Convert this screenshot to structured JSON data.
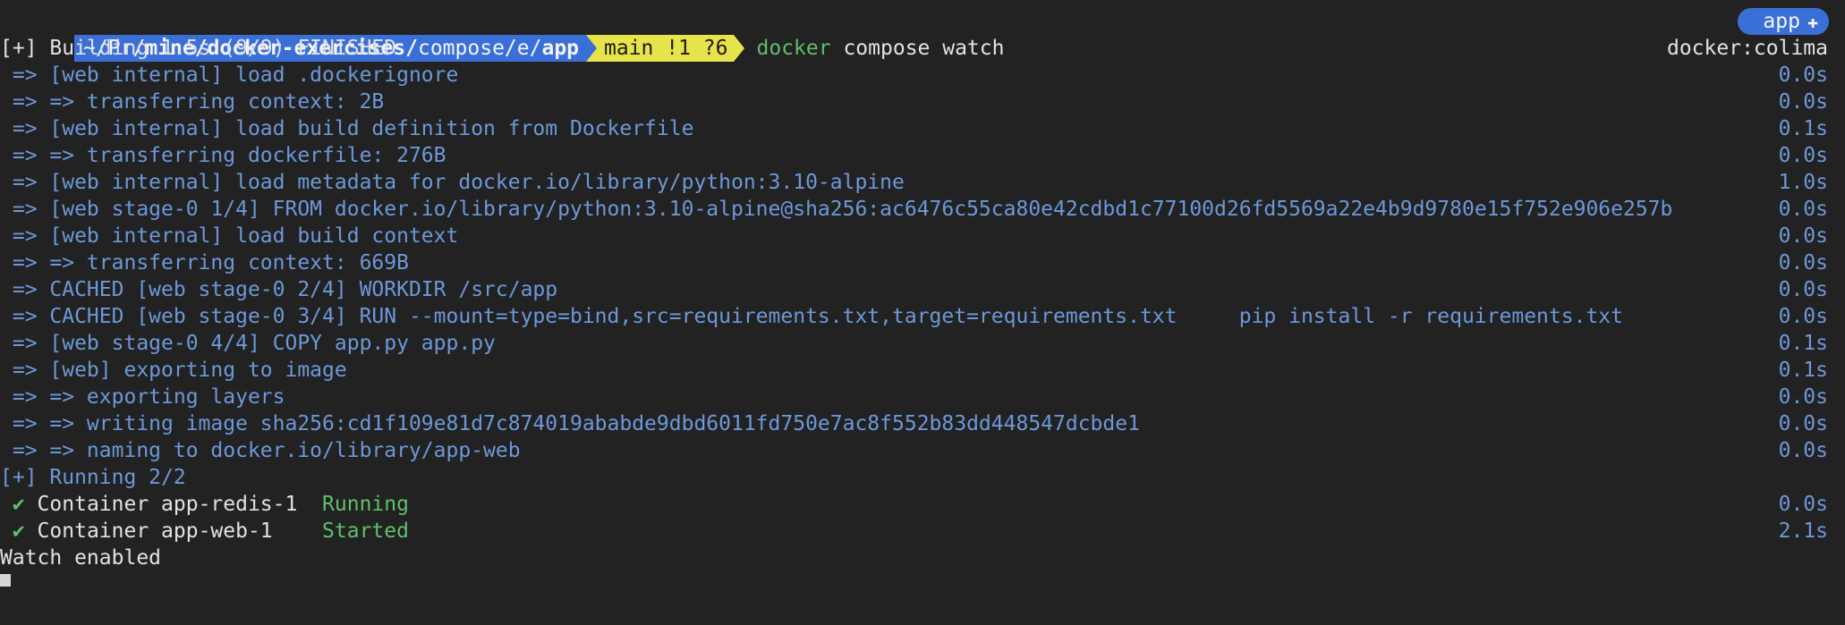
{
  "prompt": {
    "path_prefix": "~/Pr/",
    "path_bold": "mine/docker-exercises/",
    "path_tail": "compose/e/",
    "path_current": "app",
    "git_branch": "main !1 ?6",
    "command_name": "docker",
    "command_args": "compose watch",
    "badge_label": "app"
  },
  "build_header": {
    "text": "[+] Building 1.5s (9/9) FINISHED",
    "context": "docker:colima"
  },
  "steps": [
    {
      "text": " => [web internal] load .dockerignore",
      "time": "0.0s"
    },
    {
      "text": " => => transferring context: 2B",
      "time": "0.0s"
    },
    {
      "text": " => [web internal] load build definition from Dockerfile",
      "time": "0.1s"
    },
    {
      "text": " => => transferring dockerfile: 276B",
      "time": "0.0s"
    },
    {
      "text": " => [web internal] load metadata for docker.io/library/python:3.10-alpine",
      "time": "1.0s"
    },
    {
      "text": " => [web stage-0 1/4] FROM docker.io/library/python:3.10-alpine@sha256:ac6476c55ca80e42cdbd1c77100d26fd5569a22e4b9d9780e15f752e906e257b",
      "time": "0.0s"
    },
    {
      "text": " => [web internal] load build context",
      "time": "0.0s"
    },
    {
      "text": " => => transferring context: 669B",
      "time": "0.0s"
    },
    {
      "text": " => CACHED [web stage-0 2/4] WORKDIR /src/app",
      "time": "0.0s"
    },
    {
      "text": " => CACHED [web stage-0 3/4] RUN --mount=type=bind,src=requirements.txt,target=requirements.txt     pip install -r requirements.txt",
      "time": "0.0s"
    },
    {
      "text": " => [web stage-0 4/4] COPY app.py app.py",
      "time": "0.1s"
    },
    {
      "text": " => [web] exporting to image",
      "time": "0.1s"
    },
    {
      "text": " => => exporting layers",
      "time": "0.0s"
    },
    {
      "text": " => => writing image sha256:cd1f109e81d7c874019ababde9dbd6011fd750e7ac8f552b83dd448547dcbde1",
      "time": "0.0s"
    },
    {
      "text": " => => naming to docker.io/library/app-web",
      "time": "0.0s"
    }
  ],
  "running_header": "[+] Running 2/2",
  "containers": [
    {
      "check": " ✔",
      "label": " Container app-redis-1  ",
      "status": "Running",
      "time": "0.0s"
    },
    {
      "check": " ✔",
      "label": " Container app-web-1    ",
      "status": "Started",
      "time": "2.1s"
    }
  ],
  "watch_message": "Watch enabled"
}
